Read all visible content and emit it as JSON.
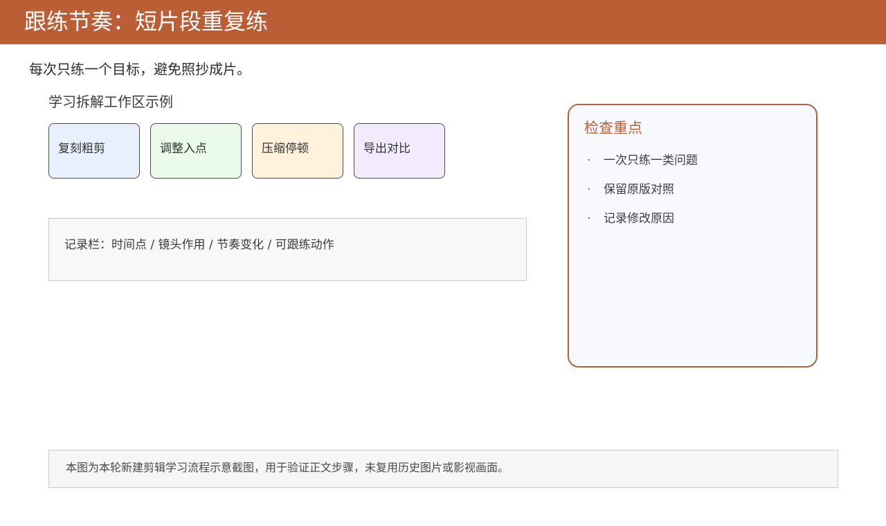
{
  "header": {
    "title": "跟练节奏：短片段重复练",
    "color": "#bb5e35"
  },
  "subtitle": "每次只练一个目标，避免照抄成片。",
  "workspace": {
    "title": "学习拆解工作区示例",
    "steps": [
      {
        "label": "复刻粗剪",
        "color": "#e8f0fe"
      },
      {
        "label": "调整入点",
        "color": "#eafbea"
      },
      {
        "label": "压缩停顿",
        "color": "#fff1dc"
      },
      {
        "label": "导出对比",
        "color": "#f1ebfd"
      }
    ],
    "record_bar": "记录栏：时间点 / 镜头作用 / 节奏变化 / 可跟练动作"
  },
  "check_panel": {
    "title": "检查重点",
    "bullet": "·",
    "items": [
      "一次只练一类问题",
      "保留原版对照",
      "记录修改原因"
    ]
  },
  "footer_note": "本图为本轮新建剪辑学习流程示意截图，用于验证正文步骤，未复用历史图片或影视画面。"
}
